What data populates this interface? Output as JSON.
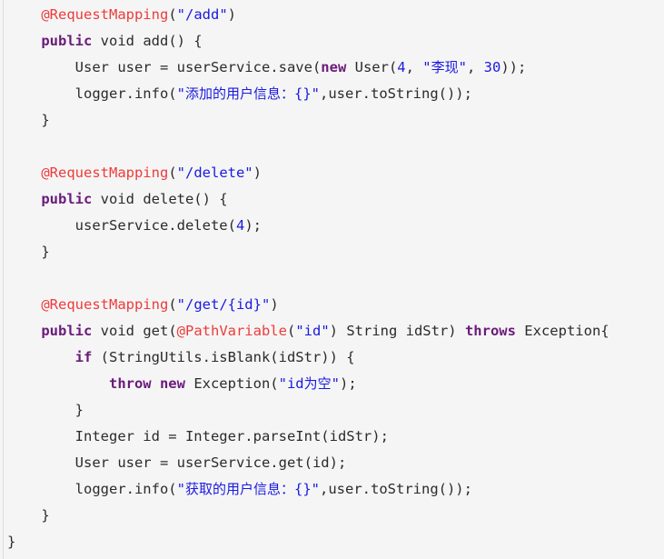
{
  "editor": {
    "language": "java",
    "background_color": "#f5f5f5",
    "plain_color": "#2b2b2b",
    "keyword_color": "#6a1b7a",
    "annotation_color": "#ee3b3b",
    "string_color": "#1a1ae0",
    "number_color": "#1a1ae0",
    "gutter_rule_color": "#dcdcdc",
    "indent_unit": "    "
  },
  "code": {
    "lines": [
      {
        "n": 1,
        "indent": 1,
        "text": "@RequestMapping(\"/add\")",
        "tokens": [
          {
            "t": "annotation",
            "v": "@RequestMapping"
          },
          {
            "t": "plain",
            "v": "("
          },
          {
            "t": "string",
            "v": "\"/add\""
          },
          {
            "t": "plain",
            "v": ")"
          }
        ]
      },
      {
        "n": 2,
        "indent": 1,
        "text": "public void add() {",
        "tokens": [
          {
            "t": "keyword",
            "v": "public"
          },
          {
            "t": "plain",
            "v": " void add() {"
          }
        ]
      },
      {
        "n": 3,
        "indent": 2,
        "text": "User user = userService.save(new User(4, \"李现\", 30));",
        "tokens": [
          {
            "t": "plain",
            "v": "User user = userService.save("
          },
          {
            "t": "keyword",
            "v": "new"
          },
          {
            "t": "plain",
            "v": " User("
          },
          {
            "t": "number",
            "v": "4"
          },
          {
            "t": "plain",
            "v": ", "
          },
          {
            "t": "string",
            "v": "\""
          },
          {
            "t": "cjk",
            "v": "李现"
          },
          {
            "t": "string",
            "v": "\""
          },
          {
            "t": "plain",
            "v": ", "
          },
          {
            "t": "number",
            "v": "30"
          },
          {
            "t": "plain",
            "v": "));"
          }
        ]
      },
      {
        "n": 4,
        "indent": 2,
        "text": "logger.info(\"添加的用户信息：{}\",user.toString());",
        "tokens": [
          {
            "t": "plain",
            "v": "logger.info("
          },
          {
            "t": "string",
            "v": "\""
          },
          {
            "t": "cjk",
            "v": "添加的用户信息："
          },
          {
            "t": "string",
            "v": "{}\""
          },
          {
            "t": "plain",
            "v": ",user.toString());"
          }
        ]
      },
      {
        "n": 5,
        "indent": 1,
        "text": "}",
        "tokens": [
          {
            "t": "plain",
            "v": "}"
          }
        ]
      },
      {
        "n": 6,
        "indent": 0,
        "text": "",
        "tokens": []
      },
      {
        "n": 7,
        "indent": 1,
        "text": "@RequestMapping(\"/delete\")",
        "tokens": [
          {
            "t": "annotation",
            "v": "@RequestMapping"
          },
          {
            "t": "plain",
            "v": "("
          },
          {
            "t": "string",
            "v": "\"/delete\""
          },
          {
            "t": "plain",
            "v": ")"
          }
        ]
      },
      {
        "n": 8,
        "indent": 1,
        "text": "public void delete() {",
        "tokens": [
          {
            "t": "keyword",
            "v": "public"
          },
          {
            "t": "plain",
            "v": " void delete() {"
          }
        ]
      },
      {
        "n": 9,
        "indent": 2,
        "text": "userService.delete(4);",
        "tokens": [
          {
            "t": "plain",
            "v": "userService.delete("
          },
          {
            "t": "number",
            "v": "4"
          },
          {
            "t": "plain",
            "v": ");"
          }
        ]
      },
      {
        "n": 10,
        "indent": 1,
        "text": "}",
        "tokens": [
          {
            "t": "plain",
            "v": "}"
          }
        ]
      },
      {
        "n": 11,
        "indent": 0,
        "text": "",
        "tokens": []
      },
      {
        "n": 12,
        "indent": 1,
        "text": "@RequestMapping(\"/get/{id}\")",
        "tokens": [
          {
            "t": "annotation",
            "v": "@RequestMapping"
          },
          {
            "t": "plain",
            "v": "("
          },
          {
            "t": "string",
            "v": "\"/get/{id}\""
          },
          {
            "t": "plain",
            "v": ")"
          }
        ]
      },
      {
        "n": 13,
        "indent": 1,
        "text": "public void get(@PathVariable(\"id\") String idStr) throws Exception{",
        "tokens": [
          {
            "t": "keyword",
            "v": "public"
          },
          {
            "t": "plain",
            "v": " void get("
          },
          {
            "t": "annotation",
            "v": "@PathVariable"
          },
          {
            "t": "plain",
            "v": "("
          },
          {
            "t": "string",
            "v": "\"id\""
          },
          {
            "t": "plain",
            "v": ") String idStr) "
          },
          {
            "t": "keyword",
            "v": "throws"
          },
          {
            "t": "plain",
            "v": " Exception{"
          }
        ]
      },
      {
        "n": 14,
        "indent": 2,
        "text": "if (StringUtils.isBlank(idStr)) {",
        "tokens": [
          {
            "t": "keyword",
            "v": "if"
          },
          {
            "t": "plain",
            "v": " (StringUtils.isBlank(idStr)) {"
          }
        ]
      },
      {
        "n": 15,
        "indent": 3,
        "text": "throw new Exception(\"id为空\");",
        "tokens": [
          {
            "t": "keyword",
            "v": "throw new"
          },
          {
            "t": "plain",
            "v": " Exception("
          },
          {
            "t": "string",
            "v": "\"id"
          },
          {
            "t": "cjk",
            "v": "为空"
          },
          {
            "t": "string",
            "v": "\""
          },
          {
            "t": "plain",
            "v": ");"
          }
        ]
      },
      {
        "n": 16,
        "indent": 2,
        "text": "}",
        "tokens": [
          {
            "t": "plain",
            "v": "}"
          }
        ]
      },
      {
        "n": 17,
        "indent": 2,
        "text": "Integer id = Integer.parseInt(idStr);",
        "tokens": [
          {
            "t": "plain",
            "v": "Integer id = Integer.parseInt(idStr);"
          }
        ]
      },
      {
        "n": 18,
        "indent": 2,
        "text": "User user = userService.get(id);",
        "tokens": [
          {
            "t": "plain",
            "v": "User user = userService.get(id);"
          }
        ]
      },
      {
        "n": 19,
        "indent": 2,
        "text": "logger.info(\"获取的用户信息：{}\",user.toString());",
        "tokens": [
          {
            "t": "plain",
            "v": "logger.info("
          },
          {
            "t": "string",
            "v": "\""
          },
          {
            "t": "cjk",
            "v": "获取的用户信息："
          },
          {
            "t": "string",
            "v": "{}\""
          },
          {
            "t": "plain",
            "v": ",user.toString());"
          }
        ]
      },
      {
        "n": 20,
        "indent": 1,
        "text": "}",
        "tokens": [
          {
            "t": "plain",
            "v": "}"
          }
        ]
      },
      {
        "n": 21,
        "indent": 0,
        "text": "}",
        "tokens": [
          {
            "t": "plain",
            "v": "}"
          }
        ]
      }
    ]
  }
}
